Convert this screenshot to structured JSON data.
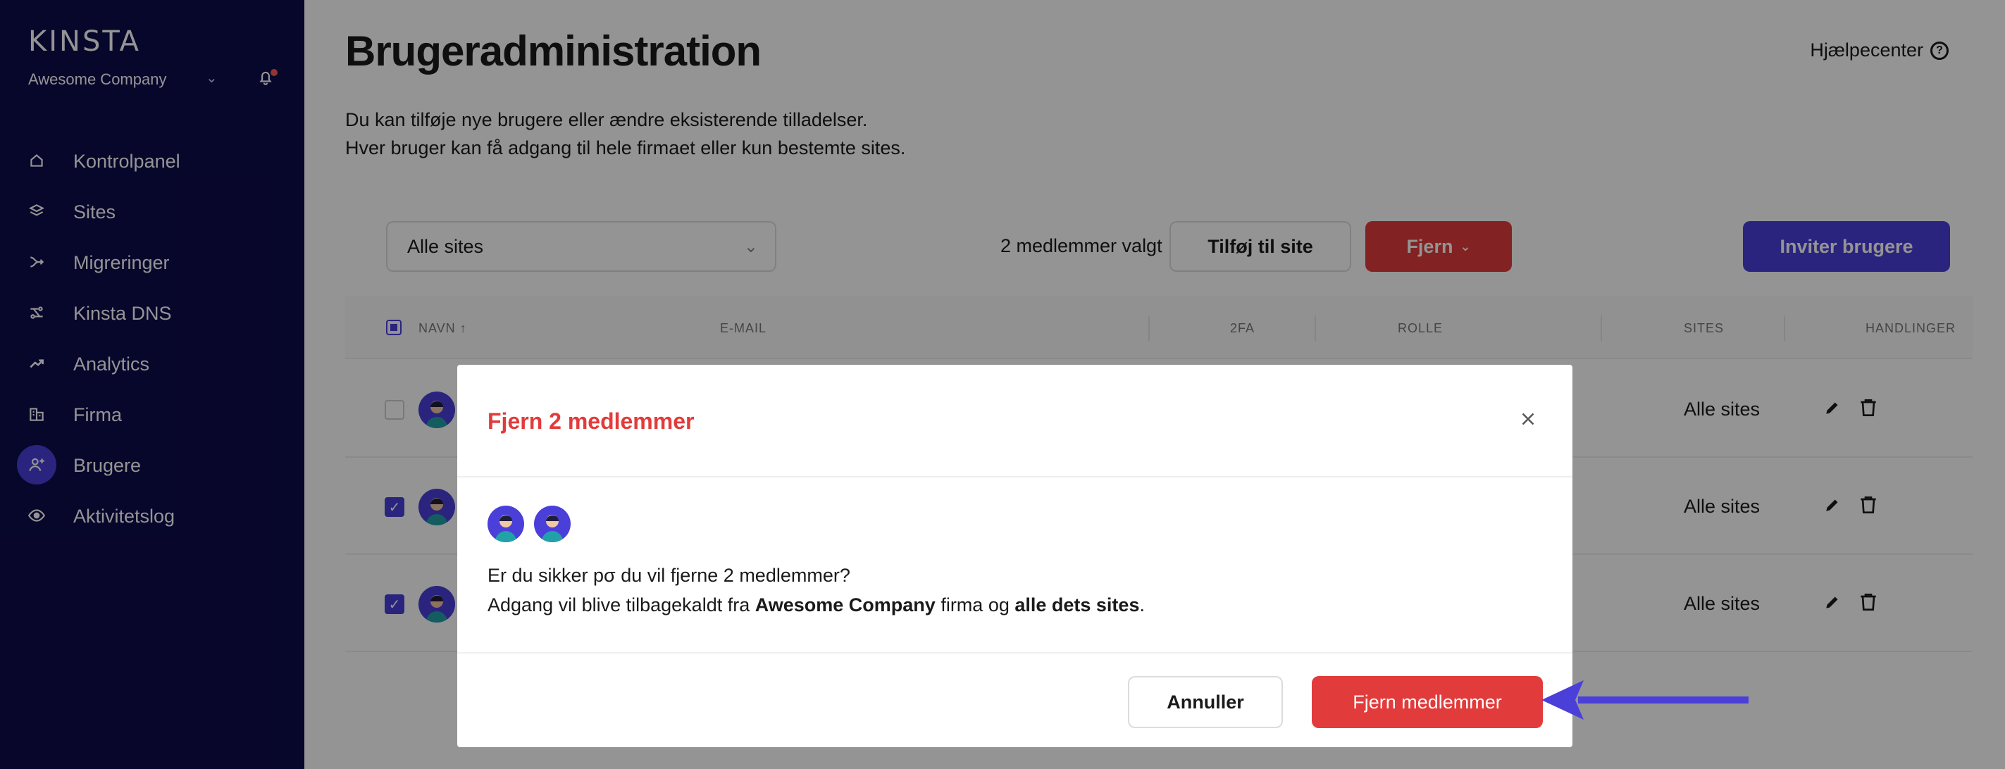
{
  "sidebar": {
    "logo": "KINSTA",
    "company": "Awesome Company",
    "items": [
      {
        "label": "Kontrolpanel",
        "icon": "home-icon"
      },
      {
        "label": "Sites",
        "icon": "layers-icon"
      },
      {
        "label": "Migreringer",
        "icon": "migrate-icon"
      },
      {
        "label": "Kinsta DNS",
        "icon": "dns-icon"
      },
      {
        "label": "Analytics",
        "icon": "trend-icon"
      },
      {
        "label": "Firma",
        "icon": "building-icon"
      },
      {
        "label": "Brugere",
        "icon": "user-add-icon",
        "active": true
      },
      {
        "label": "Aktivitetslog",
        "icon": "eye-icon"
      }
    ]
  },
  "header": {
    "title": "Brugeradministration",
    "help": "Hjælpecenter",
    "description_1": "Du kan tilføje nye brugere eller ændre eksisterende tilladelser.",
    "description_2": "Hver bruger kan få adgang til hele firmaet eller kun bestemte sites."
  },
  "toolbar": {
    "site_filter": "Alle sites",
    "selected_count": "2 medlemmer valgt",
    "add_to_site": "Tilføj til site",
    "remove": "Fjern",
    "invite": "Inviter brugere"
  },
  "table": {
    "columns": {
      "name": "NAVN",
      "email": "E-MAIL",
      "twofa": "2FA",
      "role": "ROLLE",
      "sites": "SITES",
      "actions": "HANDLINGER"
    },
    "rows": [
      {
        "checked": false,
        "sites": "Alle sites"
      },
      {
        "checked": true,
        "sites": "Alle sites"
      },
      {
        "checked": true,
        "sites": "Alle sites"
      }
    ]
  },
  "modal": {
    "title": "Fjern 2 medlemmer",
    "question": "Er du sikker pσ du vil fjerne 2 medlemmer?",
    "revoke_prefix": "Adgang vil blive tilbagekaldt fra ",
    "revoke_company": "Awesome Company",
    "revoke_middle": " firma og ",
    "revoke_scope": "alle dets sites",
    "revoke_suffix": ".",
    "cancel": "Annuller",
    "confirm": "Fjern medlemmer"
  },
  "colors": {
    "sidebar_bg": "#0d0b4a",
    "accent": "#4a3fd9",
    "danger": "#e23b3b",
    "annotation_arrow": "#4a3fd9"
  }
}
